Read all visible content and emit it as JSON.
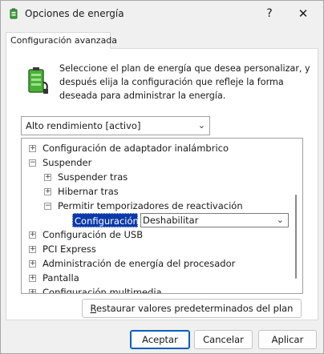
{
  "window": {
    "title": "Opciones de energía",
    "help_glyph": "?",
    "close_glyph": "✕"
  },
  "tab": {
    "label": "Configuración avanzada"
  },
  "description": "Seleccione el plan de energía que desea personalizar, y después elija la configuración que refleje la forma deseada para administrar la energía.",
  "plan_select": {
    "value": "Alto rendimiento [activo]"
  },
  "tree": {
    "items": [
      {
        "label": "Configuración de adaptador inalámbrico",
        "expander": "+"
      },
      {
        "label": "Suspender",
        "expander": "−"
      },
      {
        "label": "Suspender tras",
        "expander": "+"
      },
      {
        "label": "Hibernar tras",
        "expander": "+"
      },
      {
        "label": "Permitir temporizadores de reactivación",
        "expander": "−"
      },
      {
        "label": "Configuración de USB",
        "expander": "+"
      },
      {
        "label": "PCI Express",
        "expander": "+"
      },
      {
        "label": "Administración de energía del procesador",
        "expander": "+"
      },
      {
        "label": "Pantalla",
        "expander": "+"
      },
      {
        "label": "Configuración multimedia",
        "expander": "+"
      }
    ],
    "setting": {
      "label": "Configuración:",
      "value": "Deshabilitar"
    }
  },
  "restore_button": {
    "label_first": "R",
    "label_rest": "estaurar valores predeterminados del plan"
  },
  "buttons": {
    "accept": "Aceptar",
    "cancel": "Cancelar",
    "apply": "Aplicar"
  },
  "icons": {
    "title": "power-options-icon",
    "plan": "battery-plug-icon",
    "expand": "plus-icon",
    "collapse": "minus-icon",
    "dropdown": "chevron-down-icon"
  },
  "colors": {
    "selection": "#0b3aa8",
    "primary_border": "#005fb8"
  }
}
